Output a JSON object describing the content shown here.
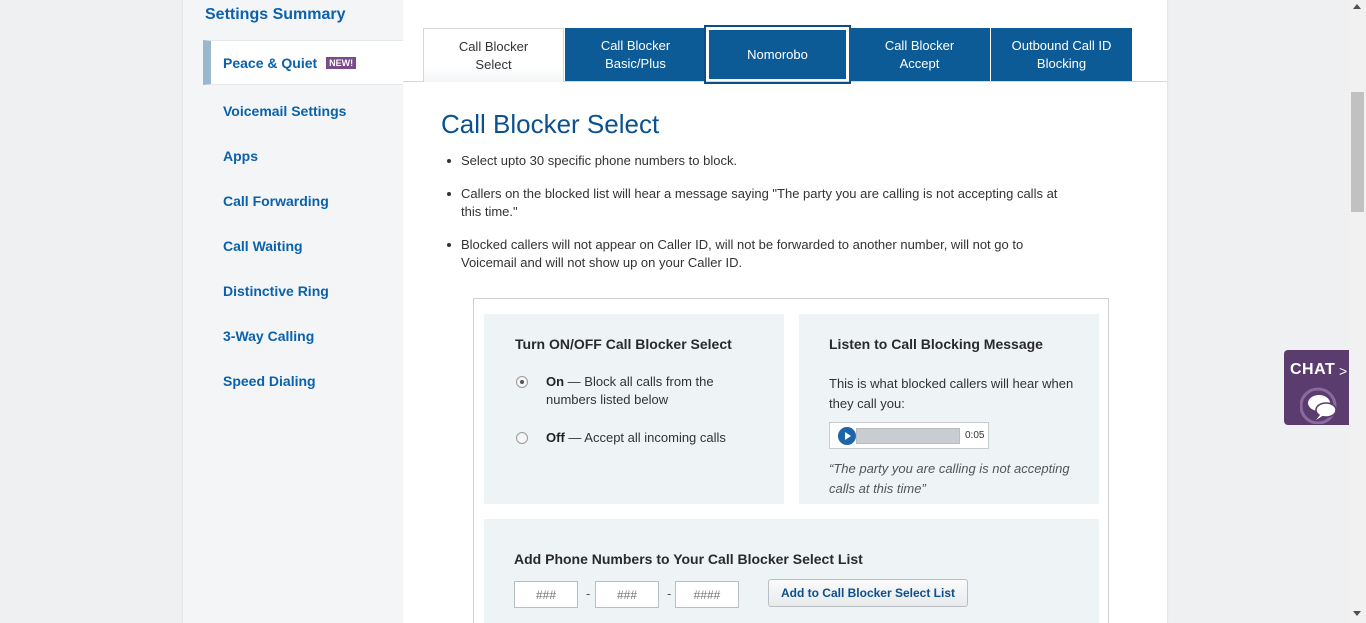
{
  "sidebar": {
    "title": "Settings Summary",
    "items": [
      {
        "label": "Peace & Quiet",
        "badge": "NEW!"
      },
      {
        "label": "Voicemail Settings"
      },
      {
        "label": "Apps"
      },
      {
        "label": "Call Forwarding"
      },
      {
        "label": "Call Waiting"
      },
      {
        "label": "Distinctive Ring"
      },
      {
        "label": "3-Way Calling"
      },
      {
        "label": "Speed Dialing"
      }
    ]
  },
  "tabs": [
    {
      "line1": "Call Blocker",
      "line2": "Select"
    },
    {
      "line1": "Call Blocker",
      "line2": "Basic/Plus"
    },
    {
      "line1": "Nomorobo",
      "line2": ""
    },
    {
      "line1": "Call Blocker",
      "line2": "Accept"
    },
    {
      "line1": "Outbound Call ID",
      "line2": "Blocking"
    }
  ],
  "main": {
    "title": "Call Blocker Select",
    "bullets": [
      "Select upto 30 specific phone numbers to block.",
      "Callers on the blocked list will hear a message saying \"The party you are calling is not accepting calls at this time.\"",
      "Blocked callers will not appear on Caller ID, will not be forwarded to another number, will not go to Voicemail and will not show up on your Caller ID."
    ]
  },
  "toggle_panel": {
    "title": "Turn ON/OFF Call Blocker Select",
    "on_label": "On",
    "on_desc": " — Block all calls from the numbers listed below",
    "off_label": "Off",
    "off_desc": " — Accept all incoming calls",
    "selected": "On"
  },
  "message_panel": {
    "title": "Listen to Call Blocking Message",
    "desc": "This is what blocked callers will hear when they call you:",
    "time": "0:05",
    "quote": "“The party you are calling is not accepting calls at this time”"
  },
  "add_panel": {
    "title": "Add Phone Numbers to Your Call Blocker Select List",
    "placeholder_area": "###",
    "placeholder_prefix": "###",
    "placeholder_line": "####",
    "dash": "-",
    "button": "Add to Call Blocker Select List"
  },
  "chat": {
    "label": "CHAT",
    "arrow": ">"
  },
  "colors": {
    "brand_blue": "#0d5b96",
    "link_blue": "#0a61ad",
    "chat_purple": "#5a3c6e",
    "badge_purple": "#7b4a8a"
  }
}
